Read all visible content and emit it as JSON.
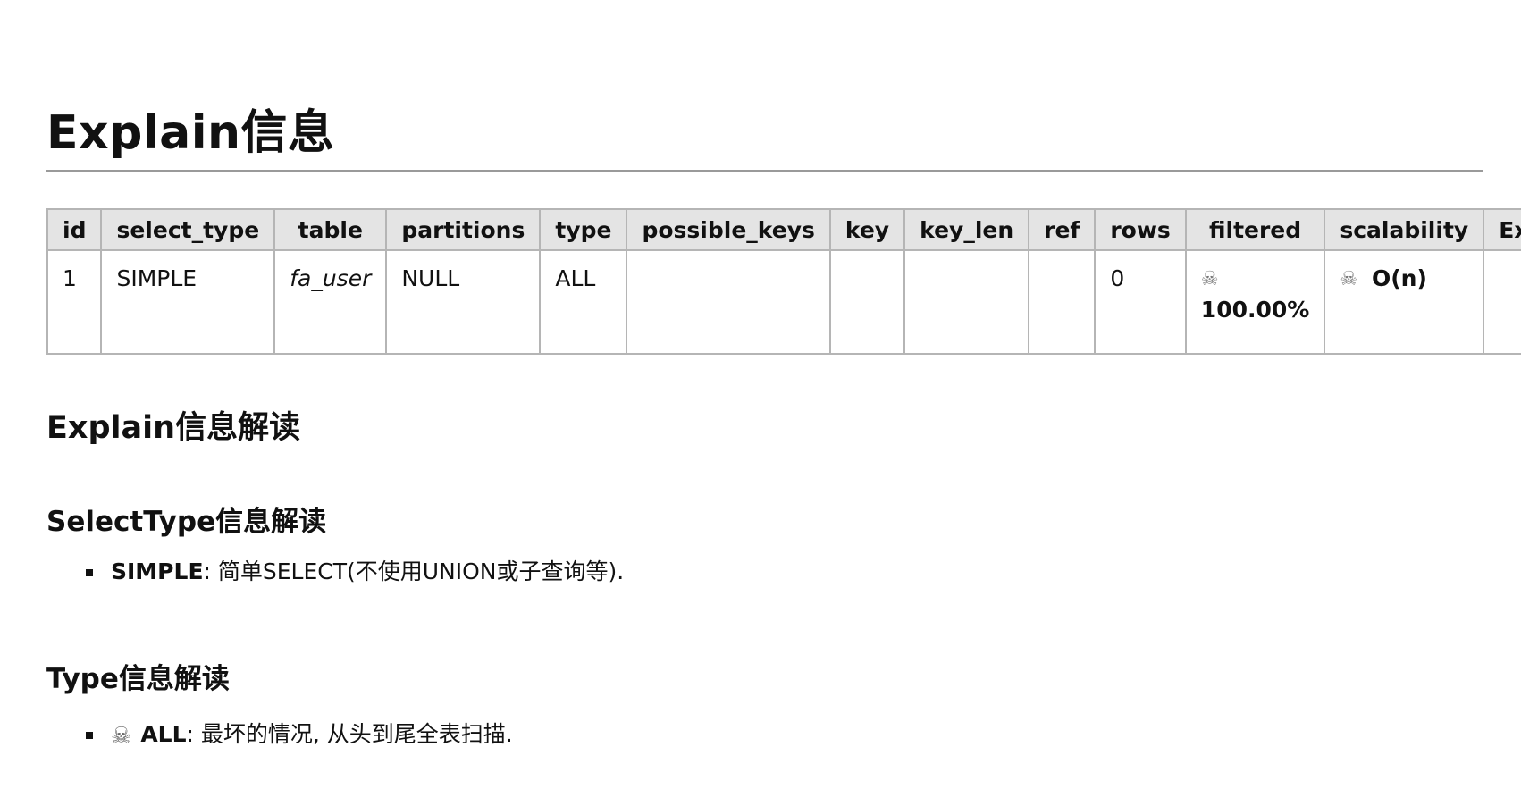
{
  "title": "Explain信息",
  "table": {
    "headers": [
      "id",
      "select_type",
      "table",
      "partitions",
      "type",
      "possible_keys",
      "key",
      "key_len",
      "ref",
      "rows",
      "filtered",
      "scalability",
      "Extra"
    ],
    "row": {
      "id": "1",
      "select_type": "SIMPLE",
      "table": "fa_user",
      "partitions": "NULL",
      "type": "ALL",
      "possible_keys": "",
      "key": "",
      "key_len": "",
      "ref": "",
      "rows": "0",
      "filtered": "100.00%",
      "scalability": "O(n)",
      "extra": ""
    },
    "warning_icon": "skull-crossbones-icon",
    "warning_glyph": "☠"
  },
  "section_title": "Explain信息解读",
  "select_type_section": {
    "title": "SelectType信息解读",
    "items": [
      {
        "term": "SIMPLE",
        "desc": ": 简单SELECT(不使用UNION或子查询等)."
      }
    ]
  },
  "type_section": {
    "title": "Type信息解读",
    "items": [
      {
        "icon": "skull-crossbones-icon",
        "glyph": "☠",
        "term": "ALL",
        "desc": ": 最坏的情况, 从头到尾全表扫描."
      }
    ]
  }
}
